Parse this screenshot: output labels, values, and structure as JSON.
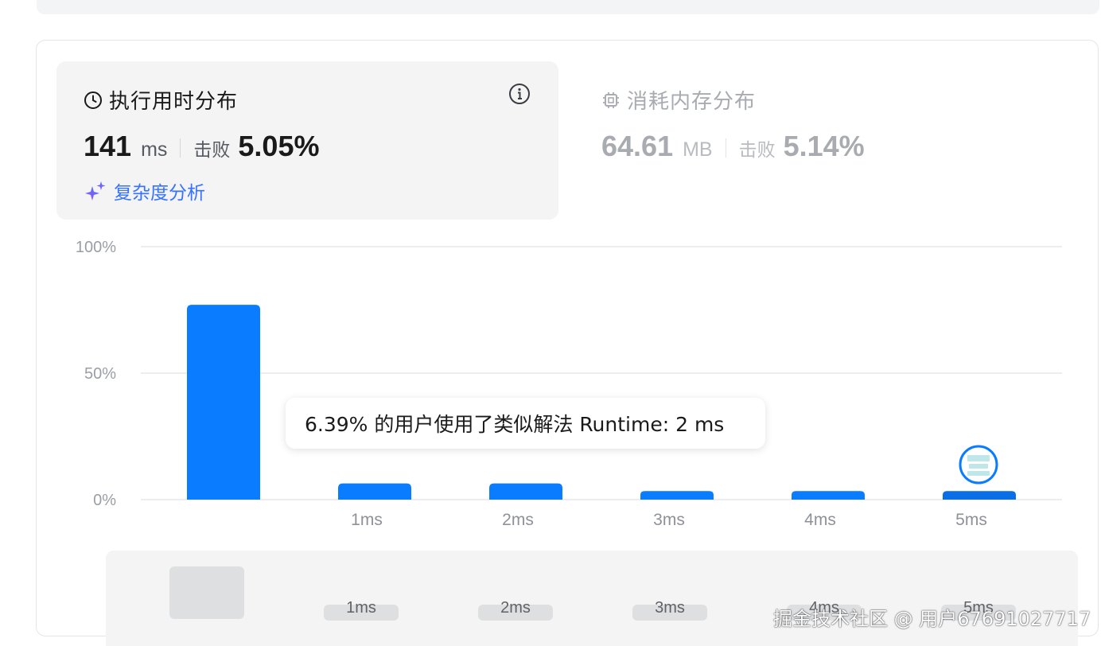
{
  "runtime": {
    "title": "执行用时分布",
    "value": "141",
    "unit": "ms",
    "beat_label": "击败",
    "beat_value": "5.05%",
    "complexity_link": "复杂度分析"
  },
  "memory": {
    "title": "消耗内存分布",
    "value": "64.61",
    "unit": "MB",
    "beat_label": "击败",
    "beat_value": "5.14%"
  },
  "tooltip": {
    "text": "6.39% 的用户使用了类似解法 Runtime: 2 ms"
  },
  "chart_data": {
    "type": "bar",
    "categories": [
      "",
      "1ms",
      "2ms",
      "3ms",
      "4ms",
      "5ms"
    ],
    "values": [
      77,
      6.4,
      6.39,
      3.4,
      3.4,
      3.4
    ],
    "y_ticks": [
      "100%",
      "50%",
      "0%"
    ],
    "ylim": [
      0,
      100
    ],
    "grid": true,
    "highlighted_category": "5ms",
    "bar_color": "#0a7cff",
    "highlight_color": "#0a6ee6"
  },
  "navigator": {
    "categories": [
      "1ms",
      "2ms",
      "3ms",
      "4ms",
      "5ms"
    ]
  },
  "watermark": "掘金技术社区 @ 用户67691027717",
  "colors": {
    "accent": "#3672ff",
    "bar": "#0a7cff",
    "card_bg": "#f4f4f5"
  }
}
